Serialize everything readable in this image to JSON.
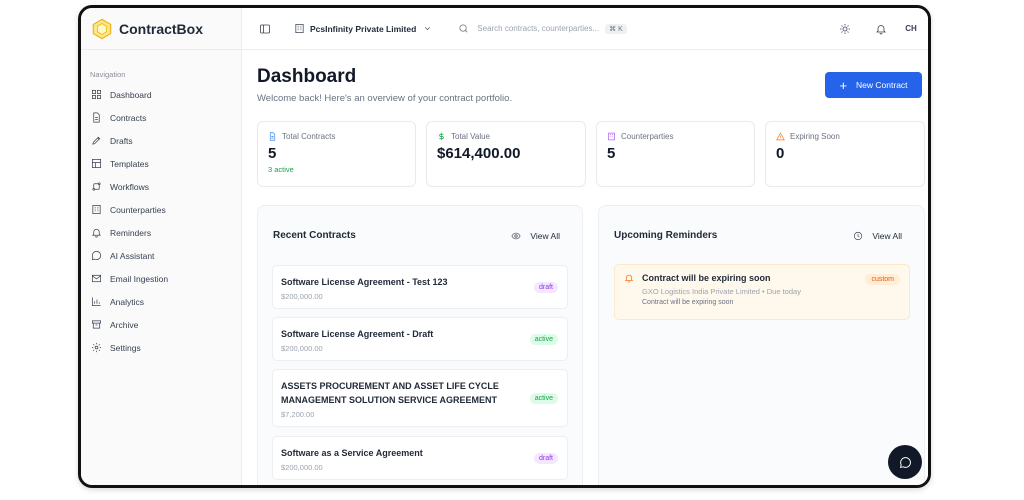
{
  "app": {
    "name": "ContractBox"
  },
  "sidebar": {
    "heading": "Navigation",
    "items": [
      {
        "label": "Dashboard",
        "icon": "grid-icon"
      },
      {
        "label": "Contracts",
        "icon": "file-icon"
      },
      {
        "label": "Drafts",
        "icon": "pen-icon"
      },
      {
        "label": "Templates",
        "icon": "layout-icon"
      },
      {
        "label": "Workflows",
        "icon": "workflow-icon"
      },
      {
        "label": "Counterparties",
        "icon": "building-icon"
      },
      {
        "label": "Reminders",
        "icon": "bell-icon"
      },
      {
        "label": "AI Assistant",
        "icon": "chat-icon"
      },
      {
        "label": "Email Ingestion",
        "icon": "mail-icon"
      },
      {
        "label": "Analytics",
        "icon": "chart-icon"
      },
      {
        "label": "Archive",
        "icon": "archive-icon"
      },
      {
        "label": "Settings",
        "icon": "gear-icon"
      }
    ]
  },
  "topbar": {
    "org_name": "PcsInfinity Private Limited",
    "search_placeholder": "Search contracts, counterparties...",
    "shortcut": "⌘ K",
    "avatar_initials": "CH"
  },
  "header": {
    "title": "Dashboard",
    "subtitle": "Welcome back! Here's an overview of your contract portfolio.",
    "new_button": "New Contract"
  },
  "stats": [
    {
      "label": "Total Contracts",
      "value": "5",
      "note": "3 active",
      "color": "#3b82f6"
    },
    {
      "label": "Total Value",
      "value": "$614,400.00",
      "note": "",
      "color": "#16a34a"
    },
    {
      "label": "Counterparties",
      "value": "5",
      "note": "",
      "color": "#a855f7"
    },
    {
      "label": "Expiring Soon",
      "value": "0",
      "note": "",
      "color": "#f97316"
    }
  ],
  "recent": {
    "title": "Recent Contracts",
    "view_all": "View All",
    "items": [
      {
        "title": "Software License Agreement - Test 123",
        "amount": "$200,000.00",
        "status": "draft"
      },
      {
        "title": "Software License Agreement - Draft",
        "amount": "$200,000.00",
        "status": "active"
      },
      {
        "title": "ASSETS PROCUREMENT AND ASSET LIFE CYCLE MANAGEMENT SOLUTION SERVICE AGREEMENT",
        "amount": "$7,200.00",
        "status": "active"
      },
      {
        "title": "Software as a Service Agreement",
        "amount": "$200,000.00",
        "status": "draft"
      }
    ]
  },
  "reminders": {
    "title": "Upcoming Reminders",
    "view_all": "View All",
    "items": [
      {
        "title": "Contract will be expiring soon",
        "meta": "GXO Logistics India Private Limited • Due today",
        "description": "Contract will be expiring soon",
        "tag": "custom"
      }
    ]
  }
}
